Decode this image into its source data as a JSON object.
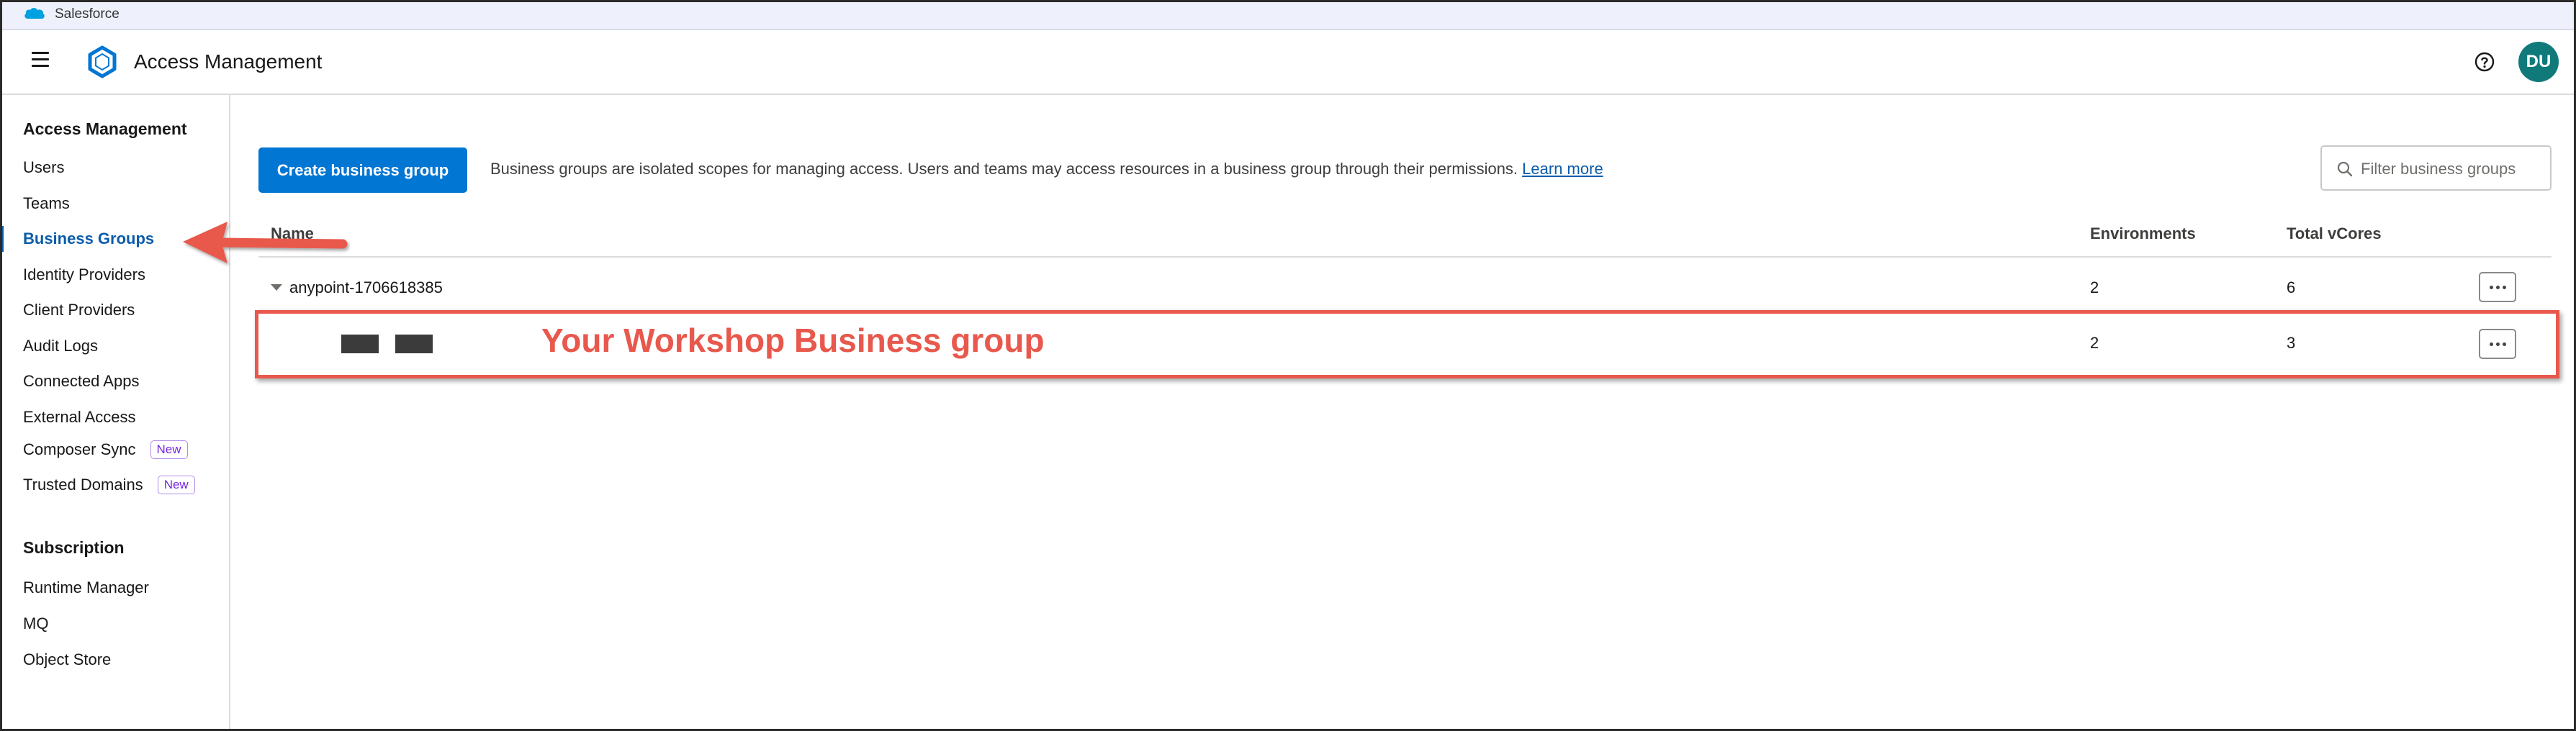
{
  "window": {
    "title": "Salesforce"
  },
  "header": {
    "app_title": "Access Management",
    "avatar_initials": "DU",
    "help_icon": "question-circle-icon"
  },
  "sidebar": {
    "section1_heading": "Access Management",
    "items": [
      {
        "label": "Users"
      },
      {
        "label": "Teams"
      },
      {
        "label": "Business Groups",
        "active": true
      },
      {
        "label": "Identity Providers"
      },
      {
        "label": "Client Providers"
      },
      {
        "label": "Audit Logs"
      },
      {
        "label": "Connected Apps"
      },
      {
        "label": "External Access"
      },
      {
        "label": "Composer Sync",
        "badge": "New"
      },
      {
        "label": "Trusted Domains",
        "badge": "New"
      }
    ],
    "section2_heading": "Subscription",
    "items2": [
      {
        "label": "Runtime Manager"
      },
      {
        "label": "MQ"
      },
      {
        "label": "Object Store"
      }
    ]
  },
  "main": {
    "create_button": "Create business group",
    "description": "Business groups are isolated scopes for managing access. Users and teams may access resources in a business group through their permissions.",
    "learn_more": "Learn more",
    "filter_placeholder": "Filter business groups",
    "columns": {
      "name": "Name",
      "environments": "Environments",
      "vcores": "Total vCores"
    },
    "rows": [
      {
        "name": "anypoint-1706618385",
        "environments": "2",
        "vcores": "6"
      },
      {
        "name": "",
        "environments": "2",
        "vcores": "3"
      }
    ]
  },
  "annotation": {
    "label": "Your Workshop Business group",
    "color": "#e8584c"
  },
  "colors": {
    "accent": "#0176d3",
    "active_text": "#0b5cab",
    "avatar": "#107a7b"
  }
}
